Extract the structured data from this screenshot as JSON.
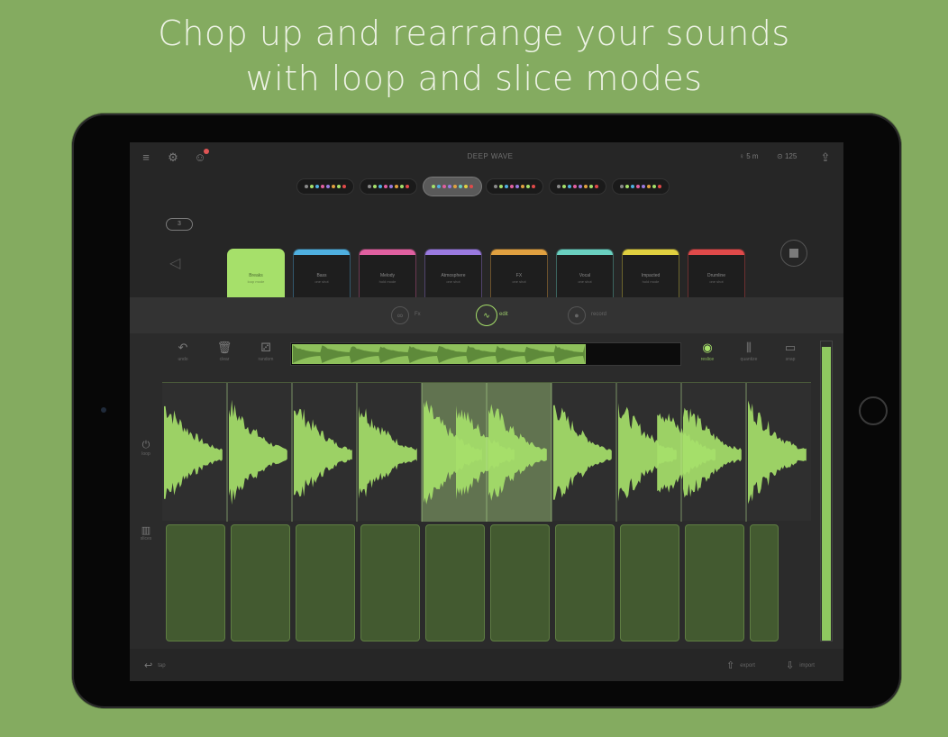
{
  "headline": {
    "line1": "Chop up and rearrange your sounds",
    "line2": "with loop and slice modes"
  },
  "topbar": {
    "title": "DEEP WAVE",
    "level": "5 m",
    "tempo": "125"
  },
  "kits": {
    "toggle_label": "3",
    "banks": [
      {
        "dots": [
          "#8a8a8a",
          "#a6e06a",
          "#4fb0e0",
          "#e060a0",
          "#9a7ae0",
          "#e0a040",
          "#a6e06a",
          "#e04a4a"
        ]
      },
      {
        "dots": [
          "#8a8a8a",
          "#a6e06a",
          "#4fb0e0",
          "#e060a0",
          "#9a7ae0",
          "#e0a040",
          "#a6e06a",
          "#e04a4a"
        ]
      },
      {
        "dots": [
          "#a6e06a",
          "#4fb0e0",
          "#e060a0",
          "#9a7ae0",
          "#e0a040",
          "#6ad0c0",
          "#e0d040",
          "#e04a4a"
        ]
      },
      {
        "dots": [
          "#8a8a8a",
          "#a6e06a",
          "#4fb0e0",
          "#e060a0",
          "#9a7ae0",
          "#e0a040",
          "#a6e06a",
          "#e04a4a"
        ]
      },
      {
        "dots": [
          "#8a8a8a",
          "#a6e06a",
          "#4fb0e0",
          "#e060a0",
          "#9a7ae0",
          "#e0a040",
          "#a6e06a",
          "#e04a4a"
        ]
      },
      {
        "dots": [
          "#8a8a8a",
          "#a6e06a",
          "#4fb0e0",
          "#e060a0",
          "#9a7ae0",
          "#e0a040",
          "#a6e06a",
          "#e04a4a"
        ]
      }
    ],
    "pads": [
      {
        "name": "Breaks",
        "sub": "loop mode",
        "color": "#a6e06a",
        "active": true
      },
      {
        "name": "Bass",
        "sub": "one shot",
        "color": "#4fb0e0",
        "active": false
      },
      {
        "name": "Melody",
        "sub": "hold mode",
        "color": "#e060a0",
        "active": false
      },
      {
        "name": "Atmosphere",
        "sub": "one shot",
        "color": "#9a7ae0",
        "active": false
      },
      {
        "name": "FX",
        "sub": "one shot",
        "color": "#e0a040",
        "active": false
      },
      {
        "name": "Vocal",
        "sub": "one shot",
        "color": "#6ad0c0",
        "active": false
      },
      {
        "name": "Impacted",
        "sub": "hold mode",
        "color": "#e0d040",
        "active": false
      },
      {
        "name": "Drumline",
        "sub": "one shot",
        "color": "#e04a4a",
        "active": false
      }
    ]
  },
  "modes": [
    {
      "label": "Fx",
      "icon": "∞",
      "active": false
    },
    {
      "label": "edit",
      "icon": "∿",
      "active": true
    },
    {
      "label": "record",
      "icon": "●",
      "active": false
    }
  ],
  "tools": [
    {
      "label": "undo",
      "icon": "↶"
    },
    {
      "label": "clear",
      "icon": "🗑"
    },
    {
      "label": "random",
      "icon": "⚂"
    }
  ],
  "tools_right": [
    {
      "label": "reslice",
      "icon": "◉"
    },
    {
      "label": "quantize",
      "icon": "⫼"
    },
    {
      "label": "snap",
      "icon": "▭"
    }
  ],
  "editor": {
    "side_top": "loop",
    "side_bottom": "slices",
    "slice_count": 10
  },
  "bottombar": {
    "left": "tap",
    "export": "export",
    "import": "import"
  },
  "colors": {
    "background": "#84ab60",
    "wave": "#a6e06a",
    "pad": "#435a30"
  }
}
